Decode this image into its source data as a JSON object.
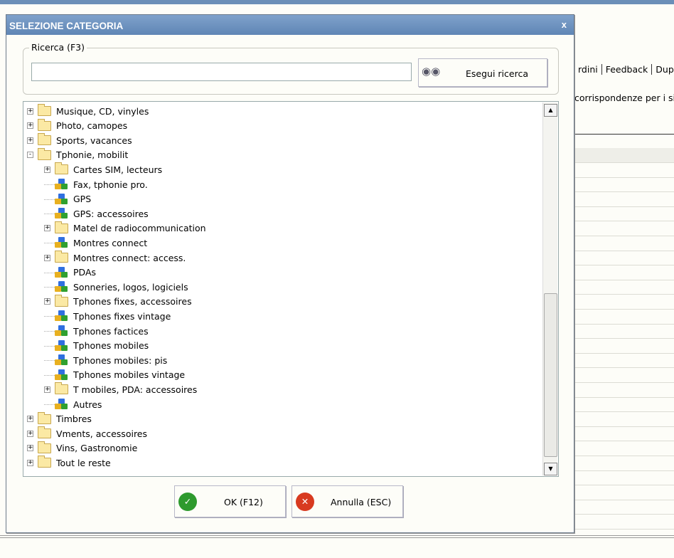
{
  "background": {
    "tabs": [
      "rdini",
      "Feedback",
      "Dup"
    ],
    "text": "corrispondenze per i siti"
  },
  "dialog": {
    "title": "SELEZIONE CATEGORIA",
    "close": "x",
    "search": {
      "label": "Ricerca (F3)",
      "value": "",
      "placeholder": "",
      "button": "Esegui ricerca",
      "button_icon": "binoculars-icon"
    },
    "tree": [
      {
        "label": "Musique, CD, vinyles",
        "level": 0,
        "type": "folder",
        "expander": "+"
      },
      {
        "label": "Photo, camopes",
        "level": 0,
        "type": "folder",
        "expander": "+"
      },
      {
        "label": "Sports, vacances",
        "level": 0,
        "type": "folder",
        "expander": "+"
      },
      {
        "label": "Tphonie, mobilit",
        "level": 0,
        "type": "folder",
        "expander": "-"
      },
      {
        "label": "Cartes SIM, lecteurs",
        "level": 1,
        "type": "folder",
        "expander": "+"
      },
      {
        "label": "Fax, tphonie pro.",
        "level": 1,
        "type": "leaf"
      },
      {
        "label": "GPS",
        "level": 1,
        "type": "leaf"
      },
      {
        "label": "GPS: accessoires",
        "level": 1,
        "type": "leaf"
      },
      {
        "label": "Matel de radiocommunication",
        "level": 1,
        "type": "folder",
        "expander": "+"
      },
      {
        "label": "Montres connect",
        "level": 1,
        "type": "leaf"
      },
      {
        "label": "Montres connect: access.",
        "level": 1,
        "type": "folder",
        "expander": "+"
      },
      {
        "label": "PDAs",
        "level": 1,
        "type": "leaf"
      },
      {
        "label": "Sonneries, logos, logiciels",
        "level": 1,
        "type": "leaf"
      },
      {
        "label": "Tphones fixes, accessoires",
        "level": 1,
        "type": "folder",
        "expander": "+"
      },
      {
        "label": "Tphones fixes vintage",
        "level": 1,
        "type": "leaf"
      },
      {
        "label": "Tphones factices",
        "level": 1,
        "type": "leaf"
      },
      {
        "label": "Tphones mobiles",
        "level": 1,
        "type": "leaf"
      },
      {
        "label": "Tphones mobiles: pis",
        "level": 1,
        "type": "leaf"
      },
      {
        "label": "Tphones mobiles vintage",
        "level": 1,
        "type": "leaf"
      },
      {
        "label": "T mobiles, PDA: accessoires",
        "level": 1,
        "type": "folder",
        "expander": "+"
      },
      {
        "label": "Autres",
        "level": 1,
        "type": "leaf"
      },
      {
        "label": "Timbres",
        "level": 0,
        "type": "folder",
        "expander": "+"
      },
      {
        "label": "Vments, accessoires",
        "level": 0,
        "type": "folder",
        "expander": "+"
      },
      {
        "label": "Vins, Gastronomie",
        "level": 0,
        "type": "folder",
        "expander": "+"
      },
      {
        "label": "Tout le reste",
        "level": 0,
        "type": "folder",
        "expander": "+"
      }
    ],
    "ok": "OK (F12)",
    "cancel": "Annulla (ESC)",
    "colors": {
      "ok": "#2e9a2e",
      "cancel": "#d83a20",
      "title": "#6a90bd"
    }
  }
}
